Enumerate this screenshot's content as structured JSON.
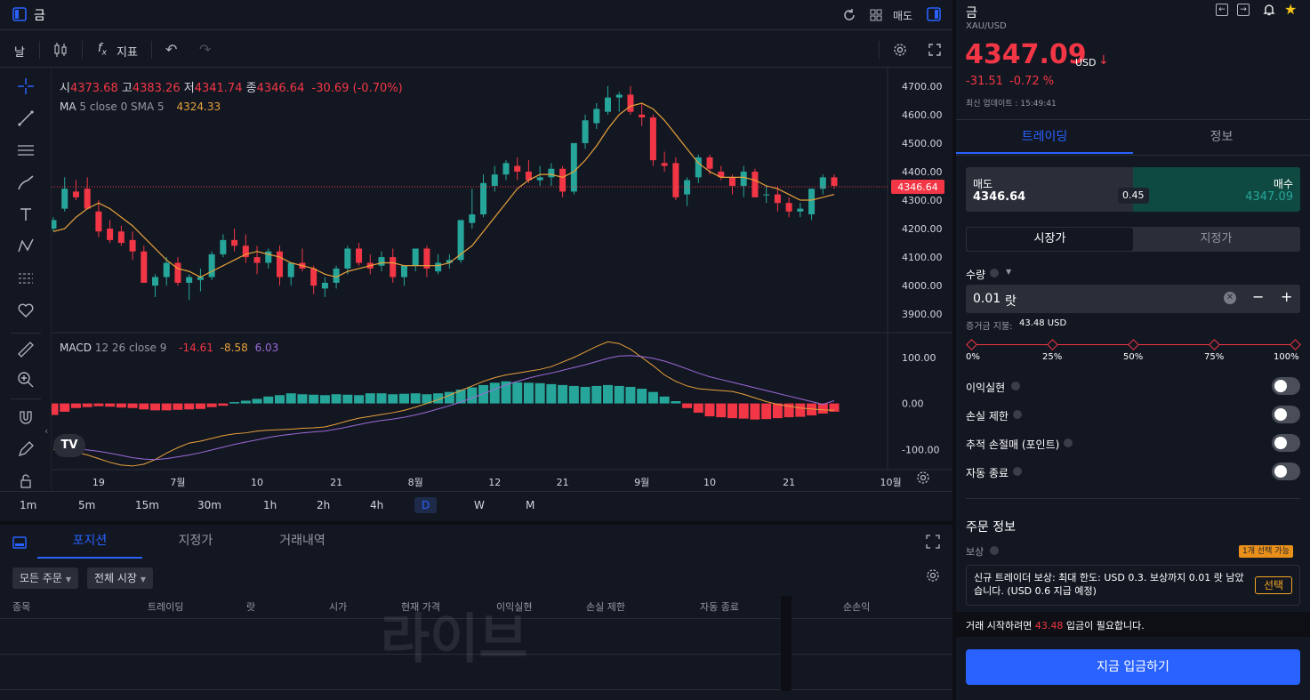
{
  "app": {
    "instrument_title": "금",
    "chart_layout_label": "매도"
  },
  "toolbar": {
    "interval": "날",
    "indicators_label": "지표"
  },
  "legend": {
    "o_label": "시",
    "o": "4373.68",
    "h_label": "고",
    "h": "4383.26",
    "l_label": "저",
    "l": "4341.74",
    "c_label": "종",
    "c": "4346.64",
    "chg": "-30.69 (-0.70%)",
    "ma_label": "MA",
    "ma_params": "5 close 0 SMA 5",
    "ma_value": "4324.33",
    "macd_label": "MACD",
    "macd_params": "12 26 close 9",
    "macd_v1": "-14.61",
    "macd_v2": "-8.58",
    "macd_v3": "6.03"
  },
  "price_axis": [
    "4700.00",
    "4600.00",
    "4500.00",
    "4400.00",
    "4300.00",
    "4200.00",
    "4100.00",
    "4000.00",
    "3900.00"
  ],
  "current_price_tag": "4346.64",
  "macd_axis": [
    "100.00",
    "0.00",
    "-100.00"
  ],
  "time_axis": [
    "19",
    "7월",
    "10",
    "21",
    "8월",
    "12",
    "21",
    "9월",
    "10",
    "21",
    "10월"
  ],
  "timeframes": [
    "1m",
    "5m",
    "15m",
    "30m",
    "1h",
    "2h",
    "4h",
    "D",
    "W",
    "M"
  ],
  "active_timeframe": "D",
  "colors": {
    "up": "#26a69a",
    "down": "#f23645",
    "ma": "#e8a13a",
    "signal": "#9c6ad8",
    "accent": "#2962ff",
    "bg": "#131722"
  },
  "chart_data": {
    "type": "candlestick",
    "ylim": [
      3860,
      4740
    ],
    "macd_ylim": [
      -140,
      150
    ],
    "candles": [
      [
        4200,
        4240,
        4190,
        4230
      ],
      [
        4270,
        4380,
        4260,
        4340
      ],
      [
        4330,
        4370,
        4300,
        4310
      ],
      [
        4340,
        4380,
        4280,
        4270
      ],
      [
        4260,
        4300,
        4170,
        4190
      ],
      [
        4200,
        4230,
        4150,
        4160
      ],
      [
        4190,
        4210,
        4140,
        4150
      ],
      [
        4160,
        4190,
        4090,
        4120
      ],
      [
        4120,
        4140,
        4020,
        4010
      ],
      [
        4000,
        4040,
        3960,
        4030
      ],
      [
        4030,
        4100,
        4000,
        4080
      ],
      [
        4080,
        4100,
        4000,
        4010
      ],
      [
        4010,
        4040,
        3950,
        4030
      ],
      [
        4020,
        4060,
        3980,
        4030
      ],
      [
        4030,
        4120,
        4020,
        4110
      ],
      [
        4110,
        4180,
        4100,
        4160
      ],
      [
        4160,
        4200,
        4120,
        4140
      ],
      [
        4140,
        4180,
        4080,
        4100
      ],
      [
        4100,
        4140,
        4040,
        4080
      ],
      [
        4080,
        4130,
        4060,
        4120
      ],
      [
        4120,
        4140,
        4000,
        4030
      ],
      [
        4030,
        4080,
        4000,
        4080
      ],
      [
        4080,
        4130,
        4050,
        4060
      ],
      [
        4060,
        4070,
        3970,
        4000
      ],
      [
        3990,
        4030,
        3960,
        4010
      ],
      [
        4010,
        4070,
        3990,
        4060
      ],
      [
        4060,
        4140,
        4040,
        4130
      ],
      [
        4130,
        4150,
        4070,
        4080
      ],
      [
        4080,
        4110,
        4040,
        4060
      ],
      [
        4070,
        4120,
        4050,
        4100
      ],
      [
        4100,
        4130,
        4010,
        4030
      ],
      [
        4030,
        4070,
        4000,
        4070
      ],
      [
        4070,
        4130,
        4050,
        4130
      ],
      [
        4130,
        4140,
        4030,
        4060
      ],
      [
        4050,
        4110,
        4040,
        4080
      ],
      [
        4080,
        4110,
        4060,
        4090
      ],
      [
        4090,
        4230,
        4080,
        4230
      ],
      [
        4220,
        4340,
        4200,
        4250
      ],
      [
        4250,
        4390,
        4240,
        4360
      ],
      [
        4350,
        4420,
        4330,
        4390
      ],
      [
        4390,
        4440,
        4370,
        4430
      ],
      [
        4420,
        4450,
        4370,
        4400
      ],
      [
        4400,
        4440,
        4360,
        4370
      ],
      [
        4370,
        4420,
        4350,
        4380
      ],
      [
        4380,
        4430,
        4350,
        4410
      ],
      [
        4410,
        4420,
        4310,
        4330
      ],
      [
        4330,
        4500,
        4320,
        4500
      ],
      [
        4500,
        4600,
        4480,
        4580
      ],
      [
        4570,
        4640,
        4550,
        4620
      ],
      [
        4610,
        4700,
        4600,
        4660
      ],
      [
        4660,
        4680,
        4610,
        4670
      ],
      [
        4670,
        4700,
        4600,
        4610
      ],
      [
        4600,
        4640,
        4560,
        4590
      ],
      [
        4590,
        4600,
        4420,
        4440
      ],
      [
        4430,
        4470,
        4400,
        4420
      ],
      [
        4430,
        4450,
        4300,
        4310
      ],
      [
        4320,
        4380,
        4280,
        4370
      ],
      [
        4380,
        4460,
        4360,
        4450
      ],
      [
        4450,
        4460,
        4390,
        4410
      ],
      [
        4400,
        4420,
        4370,
        4380
      ],
      [
        4380,
        4390,
        4320,
        4350
      ],
      [
        4350,
        4420,
        4310,
        4400
      ],
      [
        4400,
        4410,
        4310,
        4310
      ],
      [
        4320,
        4350,
        4290,
        4320
      ],
      [
        4320,
        4350,
        4260,
        4290
      ],
      [
        4290,
        4310,
        4240,
        4260
      ],
      [
        4260,
        4290,
        4240,
        4270
      ],
      [
        4250,
        4340,
        4230,
        4340
      ],
      [
        4340,
        4390,
        4320,
        4380
      ],
      [
        4380,
        4390,
        4340,
        4350
      ]
    ],
    "ma": [
      4190,
      4200,
      4240,
      4270,
      4290,
      4270,
      4240,
      4210,
      4170,
      4130,
      4090,
      4060,
      4050,
      4030,
      4050,
      4070,
      4090,
      4110,
      4120,
      4110,
      4100,
      4080,
      4070,
      4060,
      4040,
      4030,
      4050,
      4060,
      4070,
      4080,
      4080,
      4070,
      4070,
      4070,
      4070,
      4080,
      4110,
      4140,
      4190,
      4240,
      4290,
      4340,
      4370,
      4390,
      4390,
      4380,
      4400,
      4440,
      4490,
      4550,
      4600,
      4630,
      4640,
      4620,
      4580,
      4530,
      4480,
      4430,
      4400,
      4380,
      4380,
      4380,
      4370,
      4350,
      4340,
      4320,
      4300,
      4300,
      4310,
      4320
    ],
    "macd_hist": [
      -25,
      -18,
      -10,
      -8,
      -6,
      -7,
      -9,
      -10,
      -13,
      -15,
      -15,
      -14,
      -13,
      -12,
      -8,
      -5,
      3,
      6,
      10,
      15,
      18,
      22,
      20,
      19,
      18,
      20,
      19,
      18,
      22,
      22,
      20,
      21,
      22,
      20,
      22,
      25,
      30,
      35,
      40,
      45,
      48,
      46,
      45,
      44,
      42,
      40,
      38,
      36,
      38,
      40,
      38,
      36,
      32,
      25,
      15,
      5,
      -10,
      -20,
      -28,
      -30,
      -32,
      -33,
      -35,
      -34,
      -32,
      -30,
      -29,
      -26,
      -22,
      -18
    ],
    "macd_line": [
      -100,
      -103,
      -106,
      -112,
      -120,
      -128,
      -134,
      -136,
      -132,
      -122,
      -108,
      -96,
      -86,
      -82,
      -76,
      -70,
      -66,
      -64,
      -60,
      -58,
      -57,
      -56,
      -54,
      -53,
      -51,
      -45,
      -38,
      -32,
      -28,
      -24,
      -20,
      -15,
      -8,
      0,
      8,
      18,
      28,
      38,
      48,
      56,
      62,
      66,
      70,
      74,
      80,
      90,
      100,
      112,
      124,
      134,
      130,
      118,
      100,
      82,
      62,
      48,
      38,
      32,
      30,
      28,
      26,
      20,
      12,
      4,
      -2,
      -6,
      -10,
      -12,
      -14,
      -14.61
    ],
    "signal_line": [
      -95,
      -96,
      -98,
      -101,
      -104,
      -108,
      -113,
      -118,
      -121,
      -122,
      -120,
      -116,
      -112,
      -107,
      -101,
      -95,
      -89,
      -84,
      -79,
      -74,
      -70,
      -67,
      -64,
      -62,
      -60,
      -56,
      -51,
      -46,
      -41,
      -37,
      -34,
      -30,
      -25,
      -19,
      -12,
      -5,
      3,
      12,
      21,
      31,
      40,
      48,
      55,
      61,
      66,
      72,
      78,
      84,
      91,
      98,
      103,
      104,
      102,
      98,
      92,
      84,
      75,
      66,
      58,
      52,
      46,
      40,
      34,
      28,
      22,
      16,
      10,
      4,
      -2,
      6.03
    ]
  },
  "bottom": {
    "tabs": [
      "포지션",
      "지정가",
      "거래내역"
    ],
    "active_tab": "포지션",
    "filter_orders": "모든 주문",
    "filter_market": "전체 시장",
    "columns": [
      "종목",
      "트레이딩",
      "랏",
      "시가",
      "현재 가격",
      "이익실현",
      "손실 제한",
      "자동 종료",
      "순손익"
    ],
    "watermark": "라이브"
  },
  "panel": {
    "name": "금",
    "symbol": "XAU/USD",
    "price": "4347.09",
    "currency": "USD",
    "change": "-31.51",
    "change_pct": "-0.72 %",
    "updated": "최신 업데이트 : 15:49:41",
    "tabs": [
      "트레이딩",
      "정보"
    ],
    "active_tab": "트레이딩",
    "sell_label": "매도",
    "sell_price": "4346.64",
    "buy_label": "매수",
    "buy_price": "4347.09",
    "spread": "0.45",
    "order_types": [
      "시장가",
      "지정가"
    ],
    "qty_label": "수량",
    "qty_value": "0.01",
    "qty_unit": "랏",
    "margin_label": "증거금 지불:",
    "margin_value": "43.48 USD",
    "slider_marks": [
      "0%",
      "25%",
      "50%",
      "75%",
      "100%"
    ],
    "toggles": [
      "이익실현",
      "손실 제한",
      "추적 손절매 (포인트)",
      "자동 종료"
    ],
    "order_info_title": "주문 정보",
    "reward_label": "보상",
    "reward_badge": "1개 선택 가능",
    "reward_text": "신규 트레이더 보상: 최대 한도: USD 0.3. 보상까지 0.01 랏 남았습니다. (USD 0.6 지급 예정)",
    "reward_select": "선택",
    "deposit_pre": "거래 시작하려면 ",
    "deposit_amount": "43.48",
    "deposit_post": " 입금이 필요합니다.",
    "deposit_button": "지금 입금하기"
  }
}
